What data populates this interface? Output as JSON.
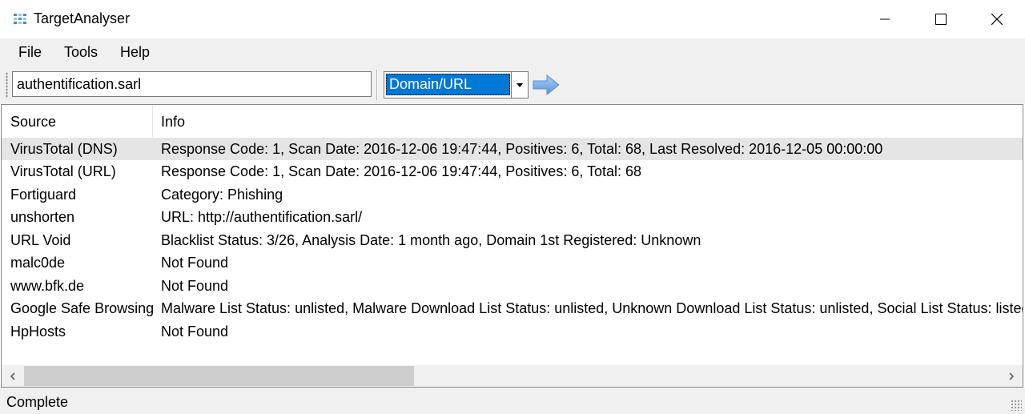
{
  "window": {
    "title": "TargetAnalyser"
  },
  "menu": [
    "File",
    "Tools",
    "Help"
  ],
  "search": {
    "value": "authentification.sarl"
  },
  "type_select": {
    "selected": "Domain/URL"
  },
  "table": {
    "columns": [
      "Source",
      "Info"
    ],
    "rows": [
      {
        "source": "VirusTotal (DNS)",
        "info": "Response Code: 1, Scan Date: 2016-12-06 19:47:44, Positives: 6, Total: 68, Last Resolved: 2016-12-05 00:00:00",
        "selected": true
      },
      {
        "source": "VirusTotal (URL)",
        "info": "Response Code: 1, Scan Date: 2016-12-06 19:47:44, Positives: 6, Total: 68"
      },
      {
        "source": "Fortiguard",
        "info": "Category: Phishing"
      },
      {
        "source": "unshorten",
        "info": "URL: http://authentification.sarl/"
      },
      {
        "source": "URL Void",
        "info": "Blacklist Status: 3/26, Analysis Date: 1 month ago, Domain 1st Registered: Unknown"
      },
      {
        "source": "malc0de",
        "info": "Not Found"
      },
      {
        "source": "www.bfk.de",
        "info": "Not Found"
      },
      {
        "source": "Google Safe Browsing",
        "info": "Malware List Status: unlisted, Malware Download List Status: unlisted, Unknown Download List Status: unlisted, Social List Status: listed, D"
      },
      {
        "source": "HpHosts",
        "info": "Not Found"
      }
    ]
  },
  "status": {
    "text": "Complete"
  },
  "colors": {
    "accent": "#0078d7",
    "arrow": "#6aa3e0",
    "selected_row": "#e5e5e5"
  },
  "icons": [
    "app-icon",
    "minimize-icon",
    "maximize-icon",
    "close-icon",
    "dropdown-arrow-icon",
    "go-arrow-icon",
    "scroll-left-icon",
    "scroll-right-icon",
    "size-grip-icon"
  ]
}
